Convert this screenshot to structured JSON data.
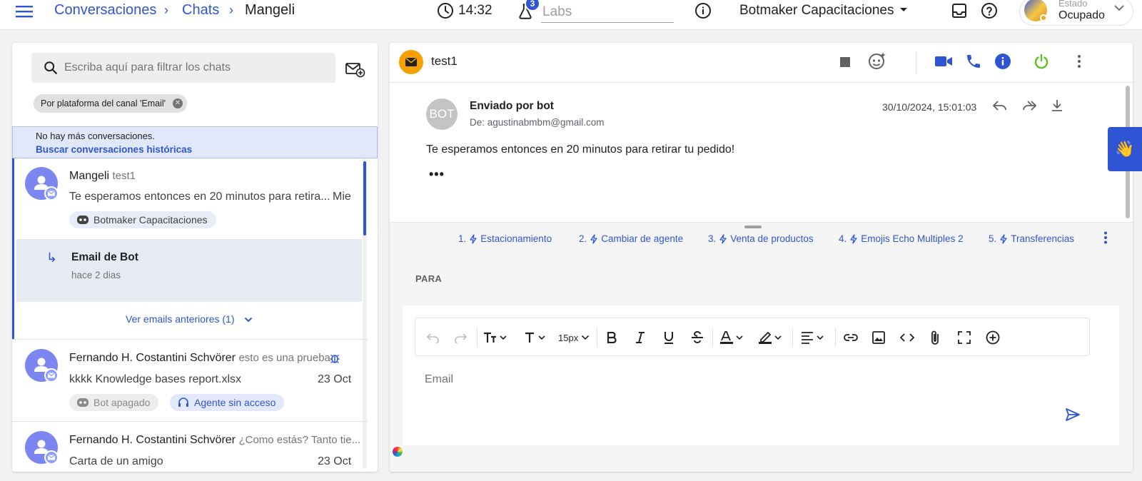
{
  "topbar": {
    "breadcrumb": [
      "Conversaciones",
      "Chats",
      "Mangeli"
    ],
    "clock": "14:32",
    "labs_badge": "3",
    "labs_placeholder": "Labs",
    "company": "Botmaker Capacitaciones",
    "status_label": "Estado",
    "status_value": "Ocupado"
  },
  "chat_list": {
    "search_placeholder": "Escriba aquí para filtrar los chats",
    "filter_chip": "Por plataforma del canal 'Email'",
    "banner_text": "No hay más conversaciones.",
    "banner_link": "Buscar conversaciones históricas",
    "items": [
      {
        "name": "Mangeli",
        "sub": "test1",
        "preview": "Te esperamos entonces en 20 minutos para retira...",
        "date": "Mie",
        "tags": [
          "Botmaker Capacitaciones"
        ],
        "sub_email": {
          "title": "Email de Bot",
          "time": "hace 2 dias"
        },
        "see_more": "Ver emails anteriores (1)"
      },
      {
        "name": "Fernando H. Costantini Schvörer",
        "sub": "esto es una prueba",
        "preview": "kkkk  Knowledge bases report.xlsx",
        "date": "23 Oct",
        "tags": [
          "Bot apagado",
          "Agente sin acceso"
        ]
      },
      {
        "name": "Fernando H. Costantini Schvörer",
        "sub": "¿Como estás? Tanto tie...",
        "preview": "Carta de un amigo",
        "date": "23 Oct"
      }
    ]
  },
  "conversation": {
    "title": "test1",
    "email": {
      "avatar_text": "BOT",
      "sent_by": "Enviado por bot",
      "from": "De: agustinabmbm@gmail.com",
      "date": "30/10/2024, 15:01:03",
      "body": "Te esperamos entonces en 20 minutos para retirar tu pedido!",
      "ellipsis": "•••"
    },
    "quick_replies": [
      {
        "num": "1.",
        "label": "Estacionamiento"
      },
      {
        "num": "2.",
        "label": "Cambiar de agente"
      },
      {
        "num": "3.",
        "label": "Venta de productos"
      },
      {
        "num": "4.",
        "label": "Emojis Echo Multiples 2"
      },
      {
        "num": "5.",
        "label": "Transferencias"
      }
    ],
    "compose": {
      "to_label": "PARA",
      "font_size": "15px",
      "placeholder": "Email"
    }
  },
  "colors": {
    "primary": "#2f55d4",
    "mail_badge": "#f5a000",
    "power_green": "#5ac21b",
    "status_busy": "#f5a623"
  },
  "icons": [
    "menu-icon",
    "clock-icon",
    "labs-flask-icon",
    "info-icon",
    "dropdown-icon",
    "inbox-icon",
    "help-icon",
    "search-icon",
    "new-email-icon",
    "stop-icon",
    "bot-face-icon",
    "video-icon",
    "phone-icon",
    "info-filled-icon",
    "power-icon",
    "more-vert-icon",
    "reply-icon",
    "reply-all-icon",
    "download-icon",
    "bolt-icon",
    "send-icon",
    "wave-hand-icon"
  ]
}
